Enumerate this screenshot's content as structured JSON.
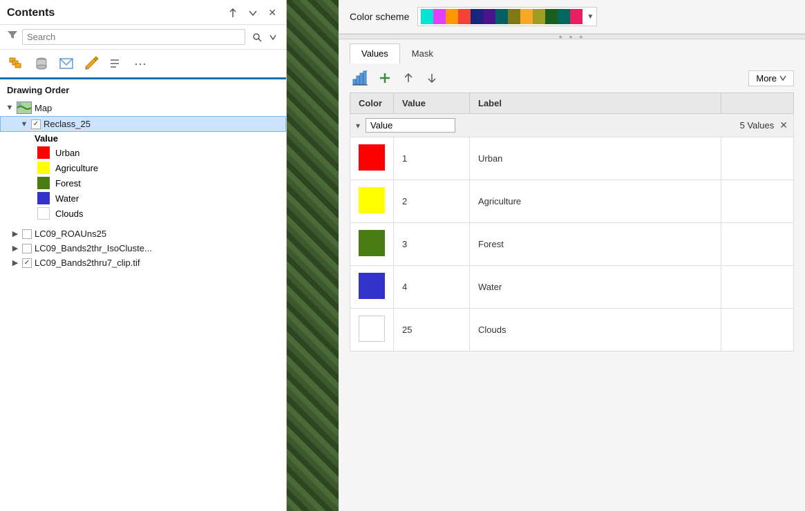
{
  "leftPanel": {
    "title": "Contents",
    "searchPlaceholder": "Search",
    "drawingOrderLabel": "Drawing Order",
    "toolbar": {
      "moreLabel": "..."
    },
    "tree": {
      "mapItem": "Map",
      "reclassItem": "Reclass_25",
      "valueGroupLabel": "Value",
      "legendItems": [
        {
          "label": "Urban",
          "color": "#ff0000"
        },
        {
          "label": "Agriculture",
          "color": "#ffff00"
        },
        {
          "label": "Forest",
          "color": "#4a7c14"
        },
        {
          "label": "Water",
          "color": "#3333cc"
        },
        {
          "label": "Clouds",
          "color": "#ffffff"
        }
      ],
      "otherLayers": [
        {
          "label": "LC09_ROAUns25",
          "checked": false
        },
        {
          "label": "LC09_Bands2thr_IsoCluste...",
          "checked": false
        },
        {
          "label": "LC09_Bands2thru7_clip.tif",
          "checked": true
        }
      ]
    }
  },
  "rightPanel": {
    "colorSchemeLabel": "Color scheme",
    "colorSwatches": [
      "#00e5d4",
      "#e040fb",
      "#ff9800",
      "#f44336",
      "#1a237e",
      "#4a148c",
      "#006064",
      "#827717",
      "#f9a825",
      "#9e9d24",
      "#1b5e20",
      "#00695c",
      "#e91e63"
    ],
    "tabs": [
      {
        "label": "Values",
        "active": true
      },
      {
        "label": "Mask",
        "active": false
      }
    ],
    "toolbar": {
      "moreLabel": "More"
    },
    "tableHeaders": [
      {
        "label": "Color"
      },
      {
        "label": "Value"
      },
      {
        "label": "Label"
      }
    ],
    "filterRow": {
      "placeholder": "Value",
      "countLabel": "5 Values"
    },
    "rows": [
      {
        "color": "#ff0000",
        "value": "1",
        "label": "Urban"
      },
      {
        "color": "#ffff00",
        "value": "2",
        "label": "Agriculture"
      },
      {
        "color": "#4a7c14",
        "value": "3",
        "label": "Forest"
      },
      {
        "color": "#3333cc",
        "value": "4",
        "label": "Water"
      },
      {
        "color": "#ffffff",
        "value": "25",
        "label": "Clouds"
      }
    ]
  }
}
